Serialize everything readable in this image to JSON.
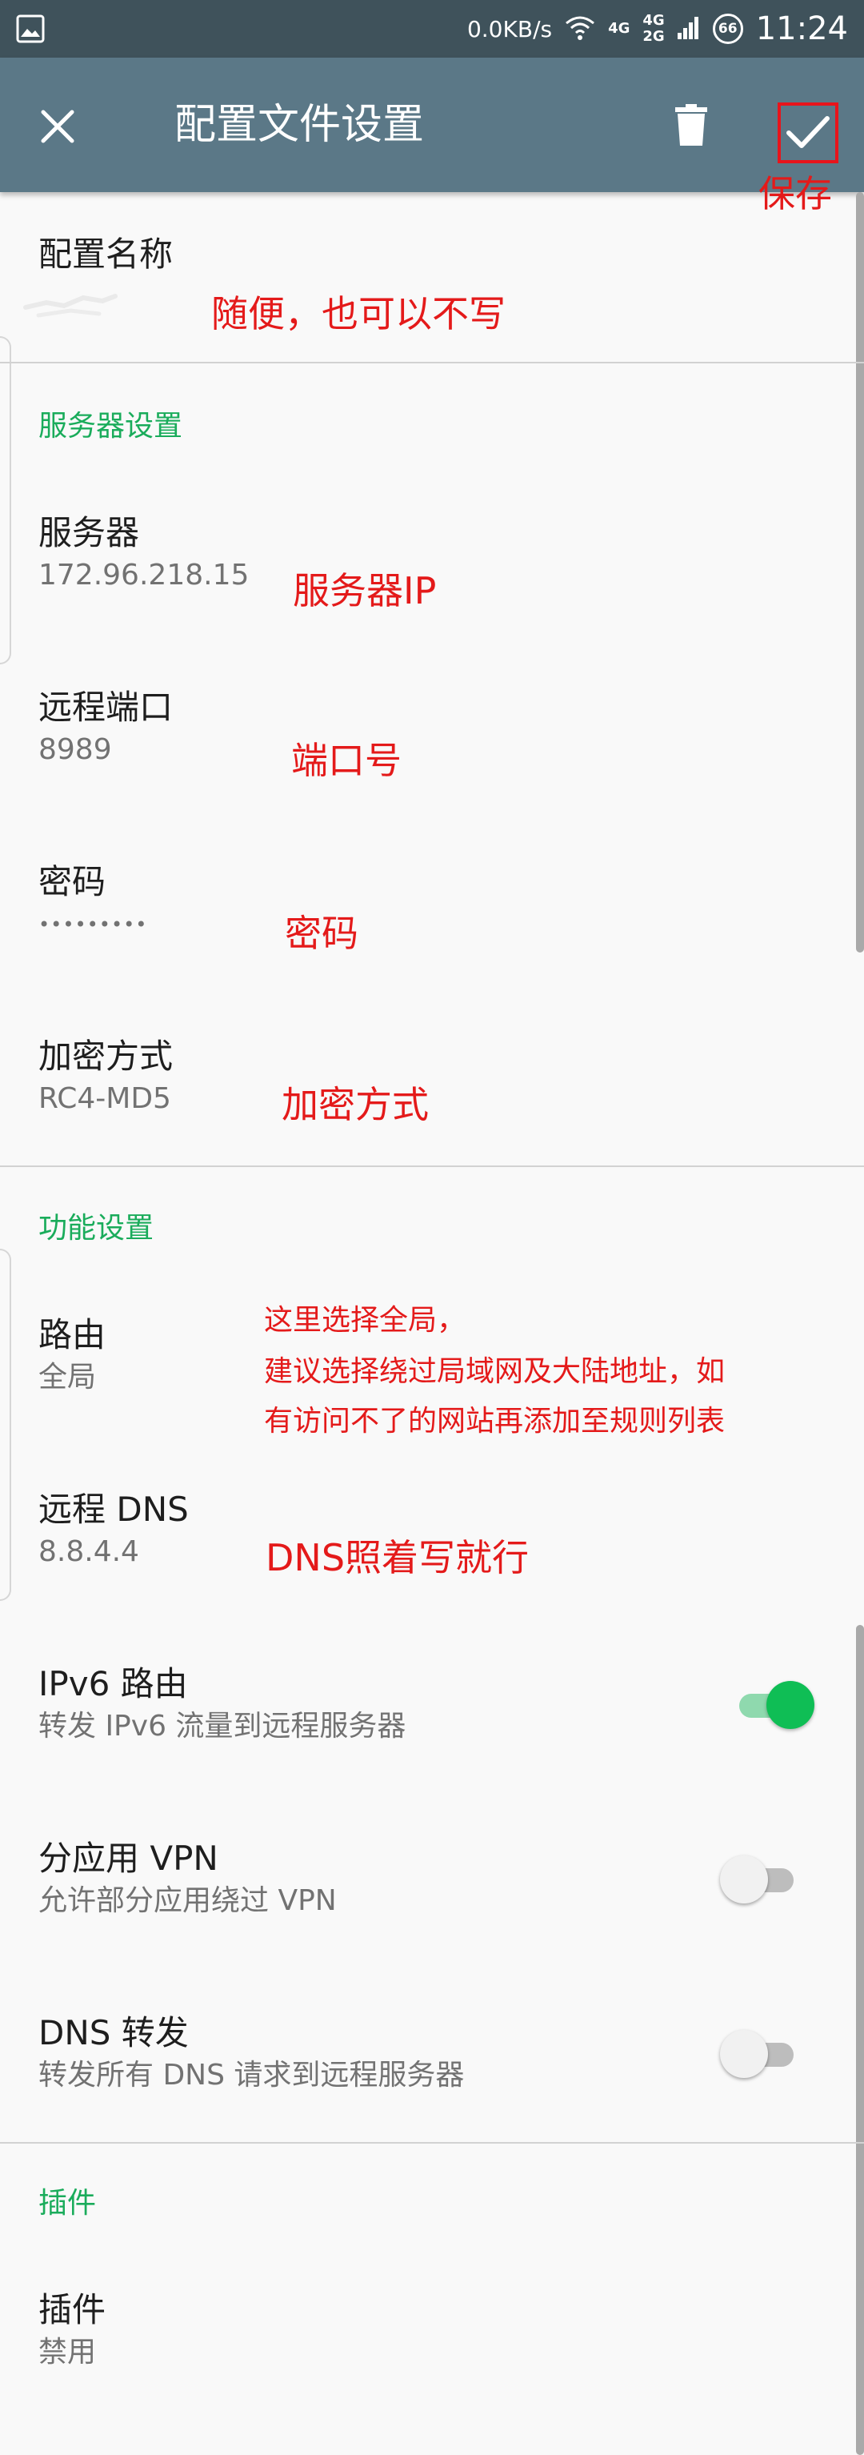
{
  "status_bar": {
    "speed": "0.0KB/s",
    "net_a": "4G",
    "net_b1": "4G",
    "net_b2": "2G",
    "battery": "66",
    "time": "11:24"
  },
  "app_bar": {
    "title": "配置文件设置",
    "icons": [
      "close-icon",
      "delete-icon",
      "check-icon"
    ]
  },
  "profile": {
    "name_label": "配置名称"
  },
  "server_section": {
    "header": "服务器设置",
    "server": {
      "label": "服务器",
      "value": "172.96.218.15"
    },
    "port": {
      "label": "远程端口",
      "value": "8989"
    },
    "password": {
      "label": "密码",
      "value": "•••••••••"
    },
    "method": {
      "label": "加密方式",
      "value": "RC4-MD5"
    }
  },
  "feature_section": {
    "header": "功能设置",
    "route": {
      "label": "路由",
      "value": "全局"
    },
    "remote_dns": {
      "label": "远程 DNS",
      "value": "8.8.4.4"
    },
    "ipv6": {
      "label": "IPv6 路由",
      "desc": "转发 IPv6 流量到远程服务器",
      "enabled": true
    },
    "per_app": {
      "label": "分应用 VPN",
      "desc": "允许部分应用绕过 VPN",
      "enabled": false
    },
    "dns_forward": {
      "label": "DNS 转发",
      "desc": "转发所有 DNS 请求到远程服务器",
      "enabled": false
    }
  },
  "plugin_section": {
    "header": "插件",
    "plugin": {
      "label": "插件",
      "value": "禁用"
    }
  },
  "annotations": {
    "save": "保存",
    "name": "随便，也可以不写",
    "server": "服务器IP",
    "port": "端口号",
    "password": "密码",
    "method": "加密方式",
    "route_1": "这里选择全局，",
    "route_2": "建议选择绕过局域网及大陆地址，如",
    "route_3": "有访问不了的网站再添加至规则列表",
    "dns": "DNS照着写就行"
  },
  "colors": {
    "status_bar": "#3f525b",
    "app_bar": "#5b7887",
    "section_header": "#1aac5b",
    "annotation": "#e41a1a",
    "toggle_on": "#0fbe55"
  }
}
